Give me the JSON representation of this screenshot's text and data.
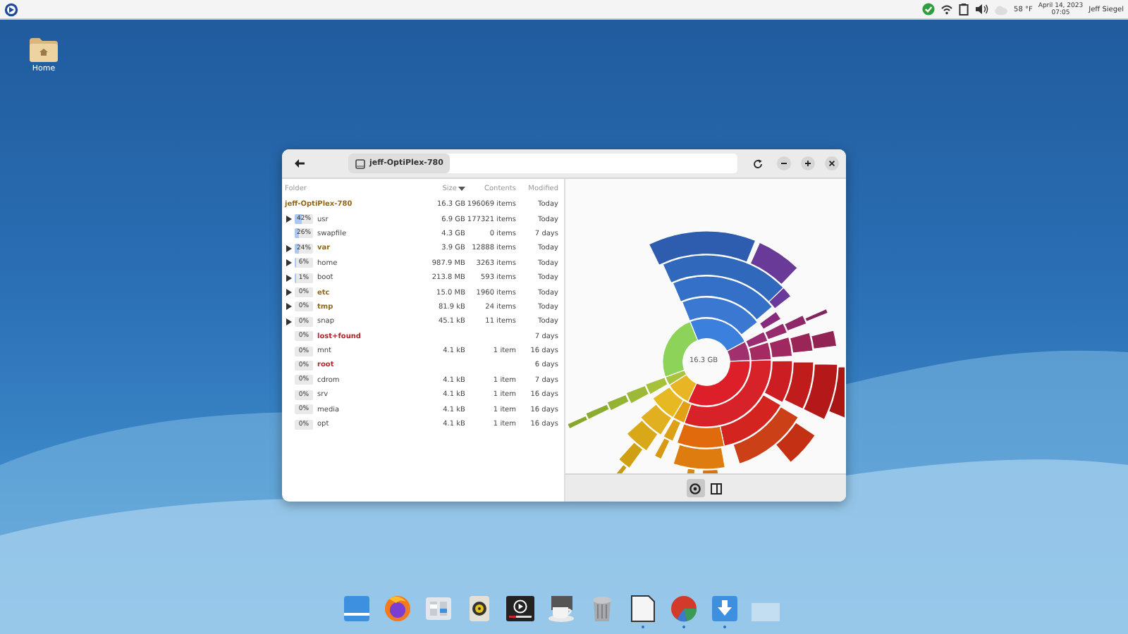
{
  "top_bar": {
    "weather": "58 °F",
    "date": "April 14, 2023",
    "time": "07:05",
    "user": "Jeff Siegel"
  },
  "desktop_icons": [
    {
      "label": "Home"
    }
  ],
  "window": {
    "tab_title": "jeff-OptiPlex-780",
    "columns": [
      "Folder",
      "Size",
      "Contents",
      "Modified"
    ],
    "rows": [
      {
        "name": "jeff-OptiPlex-780",
        "kind": "root",
        "size": "16.3 GB",
        "contents": "196069 items",
        "modified": "Today"
      },
      {
        "name": "usr",
        "kind": "normal",
        "expandable": true,
        "percent": "42%",
        "level": 0.42,
        "size": "6.9 GB",
        "contents": "177321 items",
        "modified": "Today"
      },
      {
        "name": "swapfile",
        "kind": "normal",
        "expandable": false,
        "percent": "26%",
        "level": 0.26,
        "size": "4.3 GB",
        "contents": "0 items",
        "modified": "7 days"
      },
      {
        "name": "var",
        "kind": "warning",
        "expandable": true,
        "percent": "24%",
        "level": 0.24,
        "size": "3.9 GB",
        "contents": "12888 items",
        "modified": "Today"
      },
      {
        "name": "home",
        "kind": "normal",
        "expandable": true,
        "percent": "6%",
        "level": 0.06,
        "size": "987.9 MB",
        "contents": "3263 items",
        "modified": "Today"
      },
      {
        "name": "boot",
        "kind": "normal",
        "expandable": true,
        "percent": "1%",
        "level": 0.01,
        "size": "213.8 MB",
        "contents": "593 items",
        "modified": "Today"
      },
      {
        "name": "etc",
        "kind": "warning",
        "expandable": true,
        "percent": "0%",
        "level": 0,
        "size": "15.0 MB",
        "contents": "1960 items",
        "modified": "Today"
      },
      {
        "name": "tmp",
        "kind": "warning",
        "expandable": true,
        "percent": "0%",
        "level": 0,
        "size": "81.9 kB",
        "contents": "24 items",
        "modified": "Today"
      },
      {
        "name": "snap",
        "kind": "normal",
        "expandable": true,
        "percent": "0%",
        "level": 0,
        "size": "45.1 kB",
        "contents": "11 items",
        "modified": "Today"
      },
      {
        "name": "lost+found",
        "kind": "error",
        "expandable": false,
        "percent": "0%",
        "level": 0,
        "size": "",
        "contents": "",
        "modified": "7 days"
      },
      {
        "name": "mnt",
        "kind": "normal",
        "expandable": false,
        "percent": "0%",
        "level": 0,
        "size": "4.1 kB",
        "contents": "1 item",
        "modified": "16 days"
      },
      {
        "name": "root",
        "kind": "error",
        "expandable": false,
        "percent": "0%",
        "level": 0,
        "size": "",
        "contents": "",
        "modified": "6 days"
      },
      {
        "name": "cdrom",
        "kind": "normal",
        "expandable": false,
        "percent": "0%",
        "level": 0,
        "size": "4.1 kB",
        "contents": "1 item",
        "modified": "7 days"
      },
      {
        "name": "srv",
        "kind": "normal",
        "expandable": false,
        "percent": "0%",
        "level": 0,
        "size": "4.1 kB",
        "contents": "1 item",
        "modified": "16 days"
      },
      {
        "name": "media",
        "kind": "normal",
        "expandable": false,
        "percent": "0%",
        "level": 0,
        "size": "4.1 kB",
        "contents": "1 item",
        "modified": "16 days"
      },
      {
        "name": "opt",
        "kind": "normal",
        "expandable": false,
        "percent": "0%",
        "level": 0,
        "size": "4.1 kB",
        "contents": "1 item",
        "modified": "16 days"
      }
    ],
    "chart_center": "16.3 GB",
    "views": [
      {
        "kind": "rings",
        "selected": true
      },
      {
        "kind": "treemap",
        "selected": false
      }
    ]
  },
  "dock": [
    {
      "kind": "desktop",
      "running": false
    },
    {
      "kind": "browser",
      "running": false
    },
    {
      "kind": "settings",
      "running": false
    },
    {
      "kind": "music",
      "running": false
    },
    {
      "kind": "video",
      "running": false
    },
    {
      "kind": "coffee",
      "running": false
    },
    {
      "kind": "trash",
      "running": false
    },
    {
      "kind": "document",
      "running": true
    },
    {
      "kind": "pie",
      "running": true
    },
    {
      "kind": "download",
      "running": true
    },
    {
      "kind": "empty",
      "running": false
    }
  ]
}
